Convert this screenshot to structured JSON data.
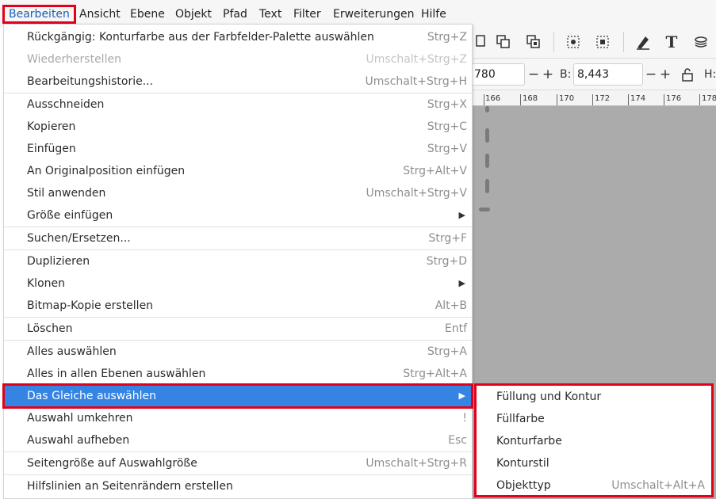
{
  "menubar": {
    "items": [
      {
        "label": "Bearbeiten",
        "active": true
      },
      {
        "label": "Ansicht"
      },
      {
        "label": "Ebene"
      },
      {
        "label": "Objekt"
      },
      {
        "label": "Pfad"
      },
      {
        "label": "Text"
      },
      {
        "label": "Filter"
      },
      {
        "label": "Erweiterungen"
      },
      {
        "label": "Hilfe"
      }
    ]
  },
  "edit_menu": {
    "items": [
      {
        "label": "Rückgängig: Konturfarbe aus der Farbfelder-Palette auswählen",
        "accel": "Strg+Z"
      },
      {
        "label": "Wiederherstellen",
        "accel": "Umschalt+Strg+Z",
        "disabled": true
      },
      {
        "label": "Bearbeitungshistorie...",
        "accel": "Umschalt+Strg+H"
      },
      {
        "label": "Ausschneiden",
        "accel": "Strg+X"
      },
      {
        "label": "Kopieren",
        "accel": "Strg+C"
      },
      {
        "label": "Einfügen",
        "accel": "Strg+V"
      },
      {
        "label": "An Originalposition einfügen",
        "accel": "Strg+Alt+V"
      },
      {
        "label": "Stil anwenden",
        "accel": "Umschalt+Strg+V"
      },
      {
        "label": "Größe einfügen",
        "submenu": true
      },
      {
        "label": "Suchen/Ersetzen...",
        "accel": "Strg+F"
      },
      {
        "label": "Duplizieren",
        "accel": "Strg+D"
      },
      {
        "label": "Klonen",
        "submenu": true
      },
      {
        "label": "Bitmap-Kopie erstellen",
        "accel": "Alt+B"
      },
      {
        "label": "Löschen",
        "accel": "Entf"
      },
      {
        "label": "Alles auswählen",
        "accel": "Strg+A"
      },
      {
        "label": "Alles in allen Ebenen auswählen",
        "accel": "Strg+Alt+A"
      },
      {
        "label": "Das Gleiche auswählen",
        "submenu": true,
        "highlighted": true
      },
      {
        "label": "Auswahl umkehren",
        "accel": "!"
      },
      {
        "label": "Auswahl aufheben",
        "accel": "Esc"
      },
      {
        "label": "Seitengröße auf Auswahlgröße",
        "accel": "Umschalt+Strg+R"
      },
      {
        "label": "Hilfslinien an Seitenrändern erstellen"
      }
    ]
  },
  "submenu_select_same": {
    "items": [
      {
        "label": "Füllung und Kontur"
      },
      {
        "label": "Füllfarbe"
      },
      {
        "label": "Konturfarbe"
      },
      {
        "label": "Konturstil"
      },
      {
        "label": "Objekttyp",
        "accel": "Umschalt+Alt+A"
      }
    ]
  },
  "controlbar": {
    "x_value": "780",
    "b_label": "B:",
    "b_value": "8,443",
    "h_label": "H:",
    "minus": "−",
    "plus": "+"
  },
  "ruler": {
    "ticks": [
      "166",
      "168",
      "170",
      "172",
      "174",
      "176",
      "178"
    ]
  },
  "icons": {
    "submenu_arrow": "submenu-arrow-icon",
    "lock": "lock-icon",
    "text_tool": "text-tool-icon"
  },
  "colors": {
    "highlight": "#3584e4",
    "annotation_red": "#e3001b",
    "canvas_gray": "#ababab"
  }
}
